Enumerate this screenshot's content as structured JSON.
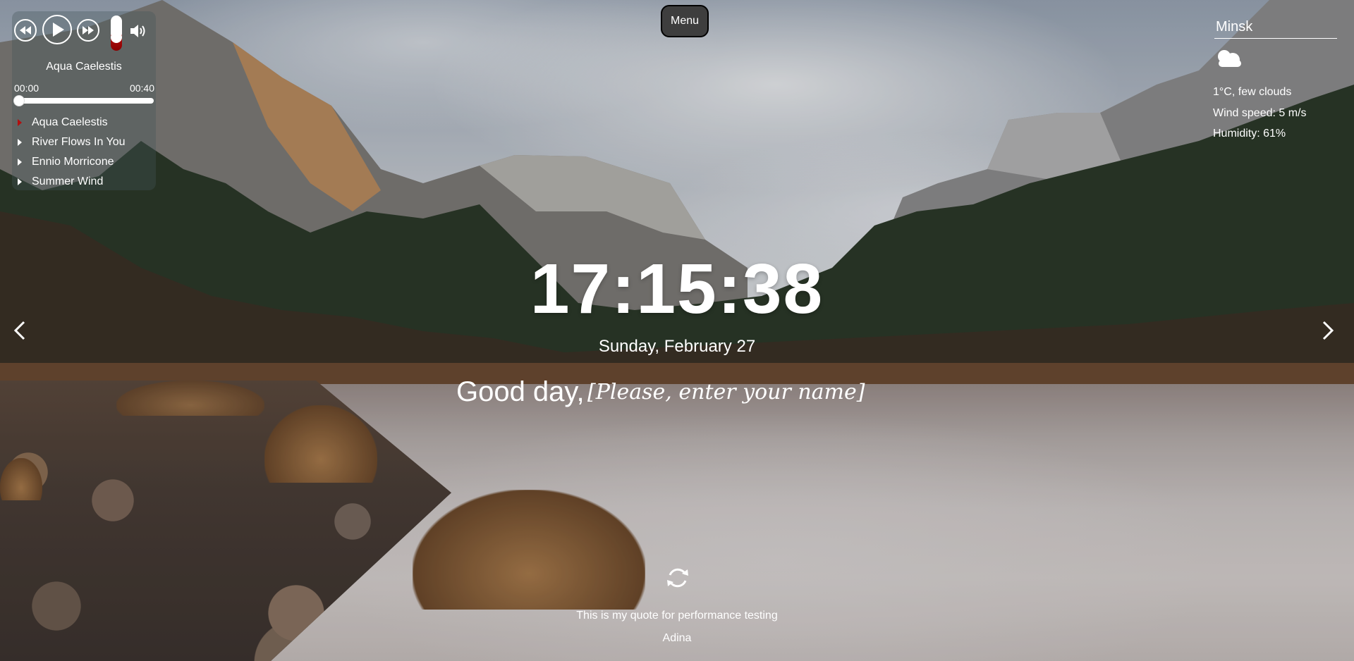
{
  "player": {
    "prev_icon": "rewind-icon",
    "play_icon": "play-icon",
    "next_icon": "fast-forward-icon",
    "volume_icon": "speaker-icon",
    "volume_level_fraction": 0.45,
    "current_track": "Aqua Caelestis",
    "current_time": "00:00",
    "duration": "00:40",
    "progress_fraction": 0.0,
    "playlist": [
      {
        "title": "Aqua Caelestis",
        "active": true
      },
      {
        "title": "River Flows In You",
        "active": false
      },
      {
        "title": "Ennio Morricone",
        "active": false
      },
      {
        "title": "Summer Wind",
        "active": false
      }
    ],
    "accent_color": "#b30f0f"
  },
  "menu": {
    "label": "Menu"
  },
  "weather": {
    "city": "Minsk",
    "icon": "cloudy-icon",
    "description": "1°C, few clouds",
    "wind": "Wind speed: 5 m/s",
    "humidity": "Humidity: 61%"
  },
  "clock": {
    "time": "17:15:38"
  },
  "date": {
    "text": "Sunday, February 27"
  },
  "greeting": {
    "text": "Good day,",
    "name_placeholder": "[Please, enter your name]"
  },
  "slider": {
    "prev_icon": "chevron-left-icon",
    "next_icon": "chevron-right-icon"
  },
  "quote": {
    "refresh_icon": "refresh-icon",
    "text": "This is my quote for performance testing",
    "author": "Adina"
  }
}
